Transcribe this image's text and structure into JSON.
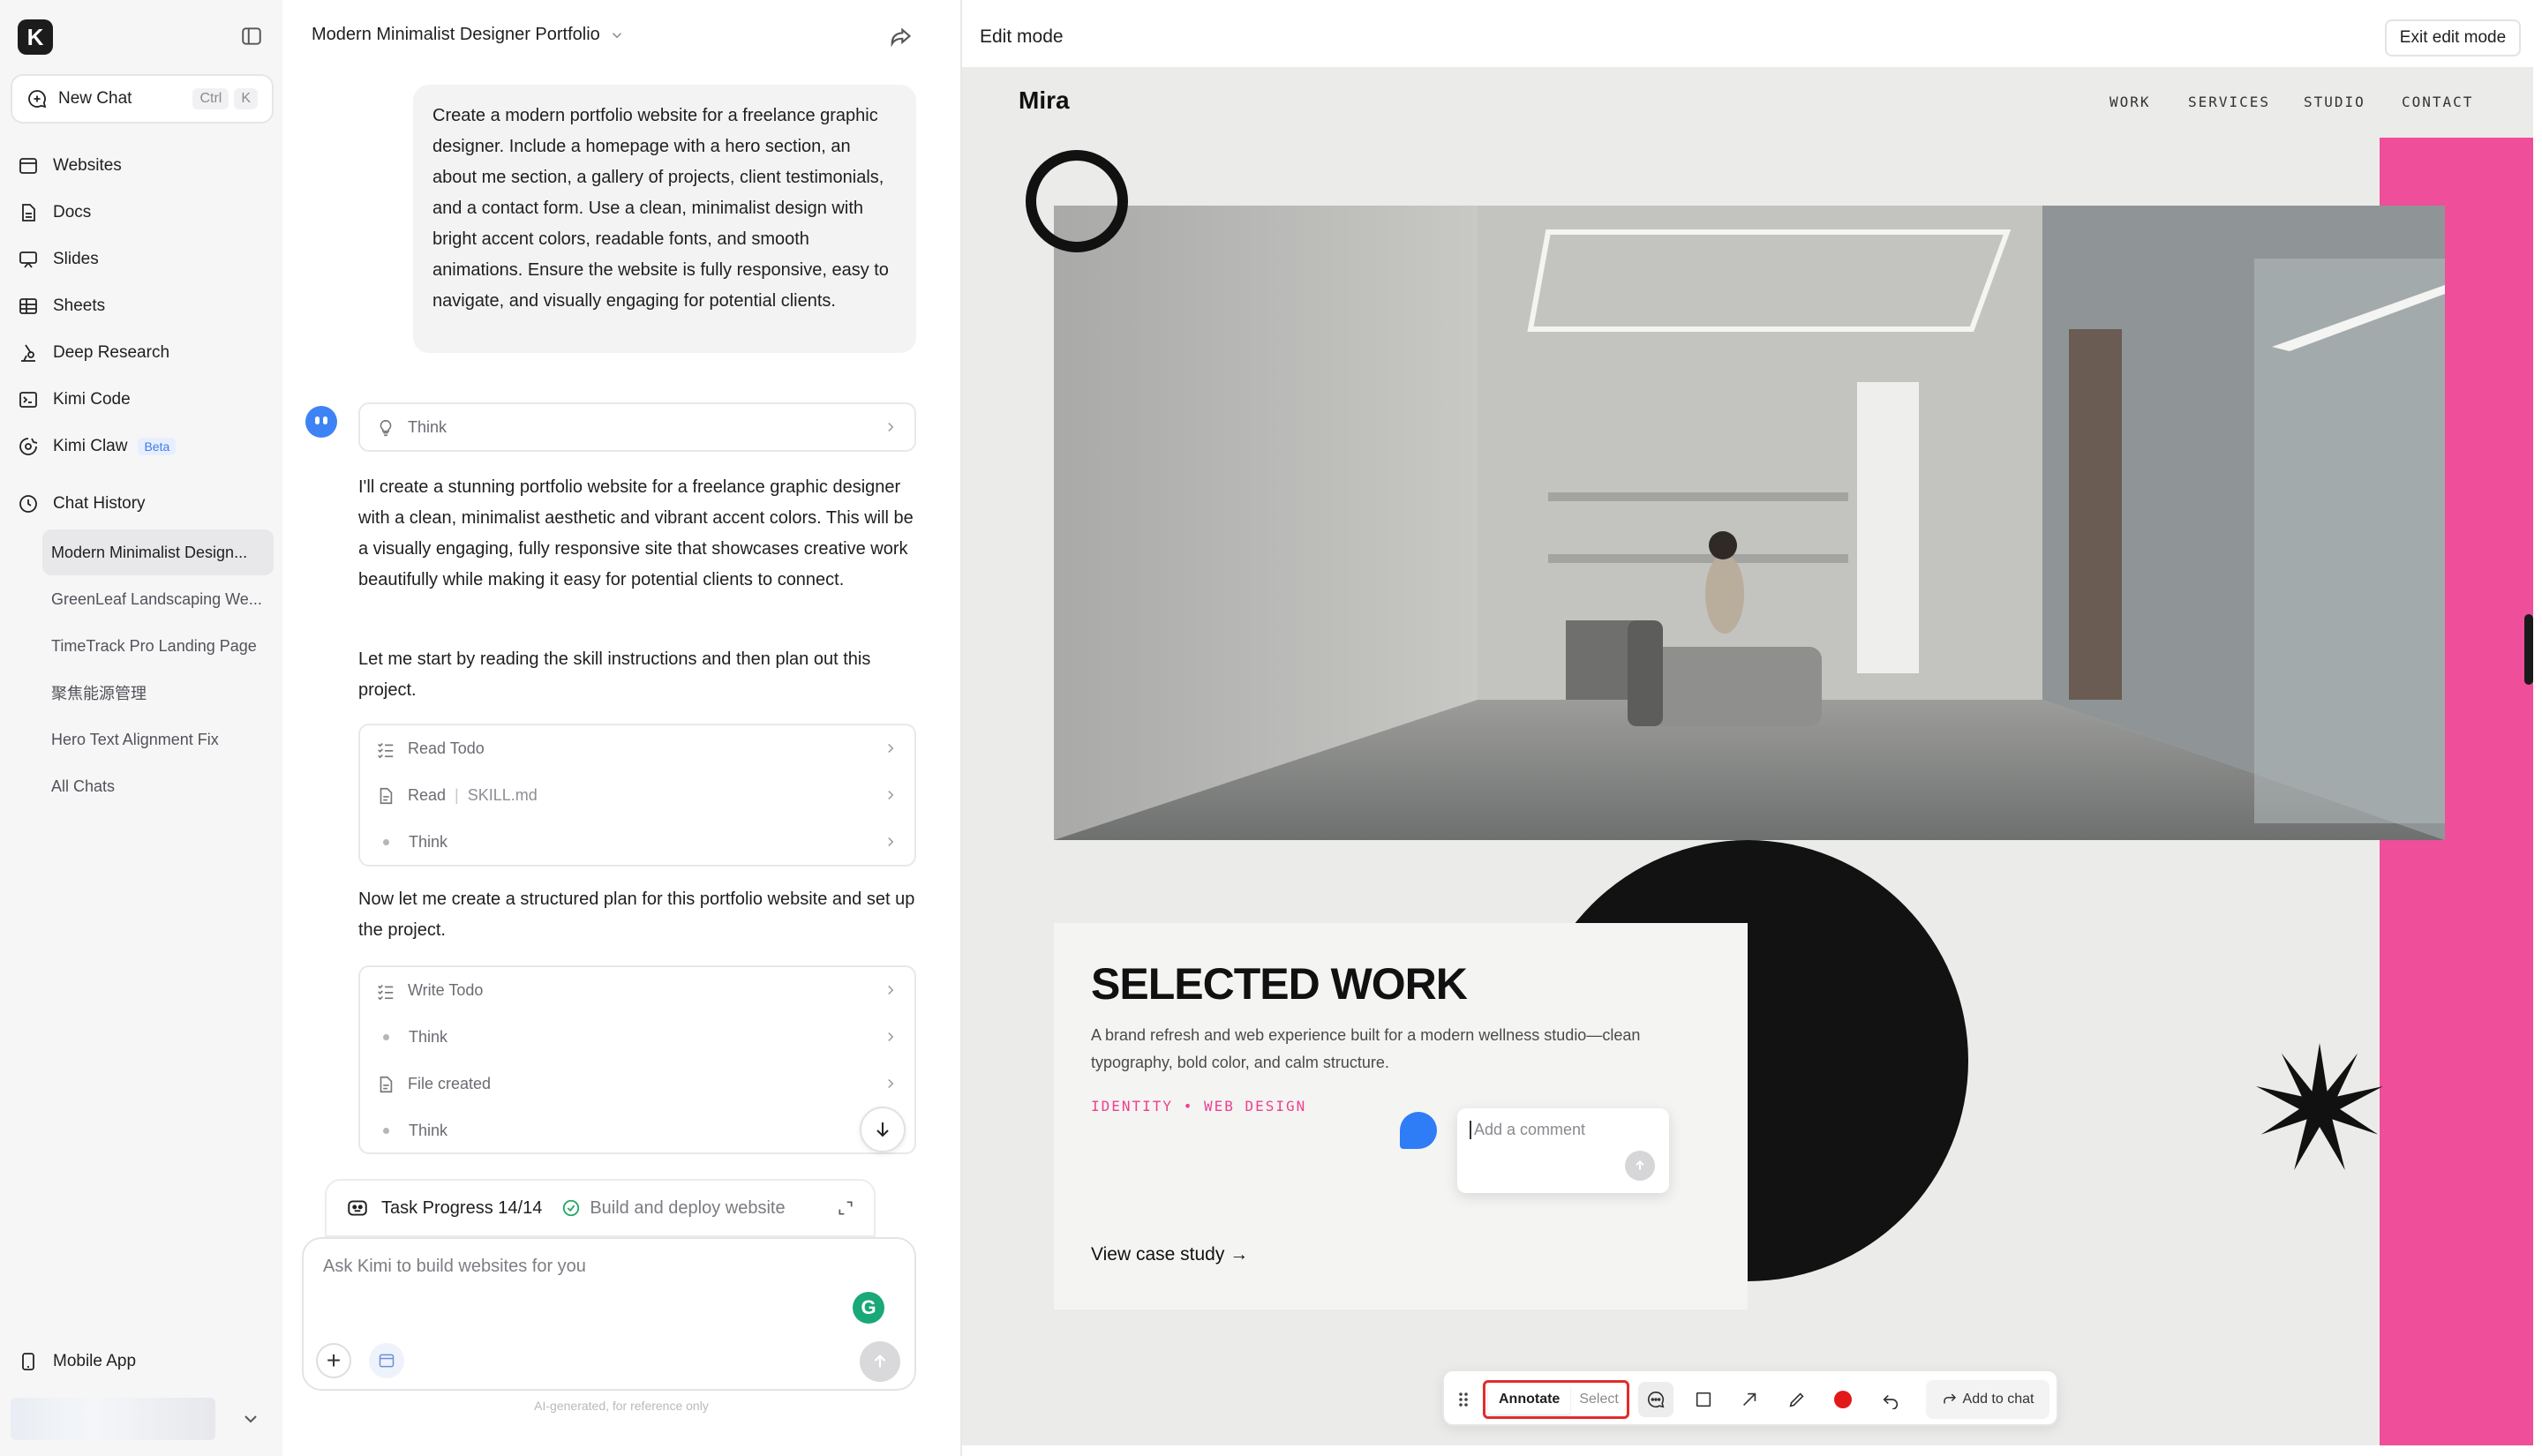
{
  "sidebar": {
    "logo_letter": "K",
    "new_chat": {
      "label": "New Chat",
      "shortcut_mod": "Ctrl",
      "shortcut_key": "K"
    },
    "nav": [
      {
        "label": "Websites",
        "icon": "browser-icon"
      },
      {
        "label": "Docs",
        "icon": "document-icon"
      },
      {
        "label": "Slides",
        "icon": "presentation-icon"
      },
      {
        "label": "Sheets",
        "icon": "table-icon"
      },
      {
        "label": "Deep Research",
        "icon": "research-icon"
      },
      {
        "label": "Kimi Code",
        "icon": "terminal-icon"
      },
      {
        "label": "Kimi Claw",
        "icon": "claw-icon",
        "badge": "Beta"
      }
    ],
    "history_label": "Chat History",
    "history": [
      "Modern Minimalist Design...",
      "GreenLeaf Landscaping We...",
      "TimeTrack Pro Landing Page",
      "聚焦能源管理",
      "Hero Text Alignment Fix",
      "All Chats"
    ],
    "mobile_app": "Mobile App"
  },
  "chat": {
    "title": "Modern Minimalist Designer Portfolio",
    "user_message": "Create a modern portfolio website for a freelance graphic designer. Include a homepage with a hero section, an about me section, a gallery of projects, client testimonials, and a contact form. Use a clean, minimalist design with bright accent colors, readable fonts, and smooth animations. Ensure the website is fully responsive, easy to navigate, and visually engaging for potential clients.",
    "think": "Think",
    "reply1": "I'll create a stunning portfolio website for a freelance graphic designer with a clean, minimalist aesthetic and vibrant accent colors. This will be a visually engaging, fully responsive site that showcases creative work beautifully while making it easy for potential clients to connect.",
    "reply2": "Let me start by reading the skill instructions and then plan out this project.",
    "steps1": [
      {
        "label": "Read Todo",
        "detail": ""
      },
      {
        "label": "Read",
        "detail": "SKILL.md"
      },
      {
        "label": "Think",
        "detail": ""
      }
    ],
    "reply3": "Now let me create a structured plan for this portfolio website and set up the project.",
    "steps2": [
      {
        "label": "Write Todo"
      },
      {
        "label": "Think"
      },
      {
        "label": "File created"
      },
      {
        "label": "Think"
      }
    ],
    "task_progress": "Task Progress 14/14",
    "task_status": "Build and deploy website",
    "input_placeholder": "Ask Kimi to build websites for you",
    "grammarly": "G",
    "disclaimer": "AI-generated, for reference only"
  },
  "preview": {
    "mode_label": "Edit mode",
    "exit_label": "Exit edit mode",
    "site": {
      "brand": "Mira",
      "menu": [
        "WORK",
        "SERVICES",
        "STUDIO",
        "CONTACT"
      ],
      "work_title": "SELECTED WORK",
      "work_desc": "A brand refresh and web experience built for a modern wellness studio—clean typography, bold color, and calm structure.",
      "work_tags": "IDENTITY • WEB DESIGN",
      "work_link": "View case study →",
      "comment_placeholder": "Add a comment"
    },
    "toolbar": {
      "annotate": "Annotate",
      "select": "Select",
      "add_to_chat": "Add to chat"
    }
  },
  "colors": {
    "accent_pink": "#ef4e9a",
    "record_red": "#e31919",
    "brand_blue": "#3d83f6"
  }
}
